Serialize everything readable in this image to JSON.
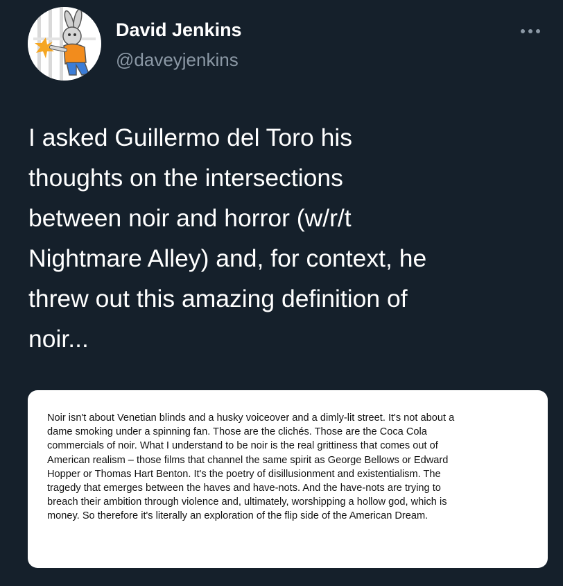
{
  "author": {
    "display_name": "David Jenkins",
    "handle": "@daveyjenkins",
    "avatar_icon": "cartoon-rabbit-avatar-icon"
  },
  "more_icon": "more-options-icon",
  "tweet": {
    "text_lines": [
      "I asked Guillermo del Toro his",
      "thoughts on the intersections",
      "between noir and horror (w/r/t",
      "Nightmare Alley) and, for context, he",
      "threw out this amazing definition of",
      "noir..."
    ]
  },
  "media": {
    "quote_lines": [
      "Noir isn't about Venetian blinds and a husky voiceover and a dimly-lit street. It's not about a",
      "dame smoking under a spinning fan. Those are the clichés. Those are the Coca Cola",
      "commercials of noir. What I understand to be noir is the real grittiness that comes out of",
      "American realism – those films that channel the same spirit as George Bellows or Edward",
      "Hopper or Thomas Hart Benton. It's the poetry of disillusionment and existentialism. The",
      "tragedy that emerges between the haves and have-nots. And the have-nots are trying to",
      "breach their ambition through violence and, ultimately, worshipping a hollow god, which is",
      "money. So therefore it's literally an exploration of the flip side of the American Dream."
    ]
  },
  "colors": {
    "background": "#15202b",
    "name_text": "#ffffff",
    "handle_text": "#8b98a5",
    "card_background": "#ffffff"
  }
}
